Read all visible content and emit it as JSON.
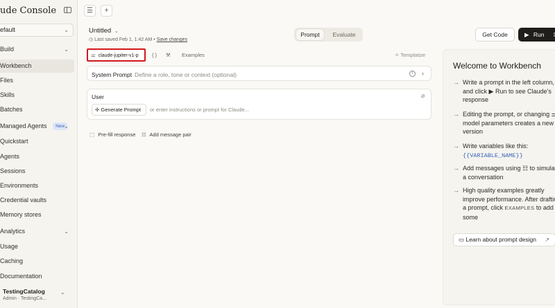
{
  "sidebar": {
    "brand": "ude Console",
    "workspace": "efault",
    "items": [
      {
        "label": "Build",
        "chevron": true
      },
      {
        "label": "Workbench",
        "active": true
      },
      {
        "label": "Files"
      },
      {
        "label": "Skills"
      },
      {
        "label": "Batches"
      },
      {
        "label": "Managed Agents",
        "badge": "New",
        "chevron": true
      },
      {
        "label": "Quickstart"
      },
      {
        "label": "Agents"
      },
      {
        "label": "Sessions"
      },
      {
        "label": "Environments"
      },
      {
        "label": "Credential vaults"
      },
      {
        "label": "Memory stores"
      },
      {
        "label": "Analytics",
        "chevron": true
      },
      {
        "label": "Usage"
      },
      {
        "label": "Caching"
      },
      {
        "label": "Documentation"
      }
    ],
    "user": {
      "name": "TestingCatalog",
      "sub": "Admin · TestingCa..."
    }
  },
  "header": {
    "doc_title": "Untitled",
    "saved_text": "Last saved Feb 1, 1:42 AM",
    "save_changes": "Save changes",
    "tabs": [
      "Prompt",
      "Evaluate"
    ],
    "active_tab": "Prompt",
    "get_code": "Get Code",
    "run": "Run"
  },
  "editor": {
    "model": "claude-jupiter-v1-p",
    "examples": "Examples",
    "templatize": "Templatize",
    "system_prompt_label": "System Prompt",
    "system_prompt_placeholder": "Define a role, tone or context (optional)",
    "user_label": "User",
    "generate_prompt": "Generate Prompt",
    "generate_placeholder": "or enter instructions or prompt for Claude...",
    "prefill": "Pre-fill response",
    "add_pair": "Add message pair"
  },
  "welcome": {
    "title": "Welcome to Workbench",
    "item1_a": "Write a prompt in the left column, and click",
    "item1_b": "Run to see Claude’s response",
    "item2_a": "Editing the prompt, or changing",
    "item2_b": "model parameters creates a new version",
    "item3_a": "Write variables like this:",
    "item3_var": "{{VARIABLE_NAME}}",
    "item4_a": "Add messages using",
    "item4_b": "to simulate a conversation",
    "item5_a": "High quality examples greatly improve performance. After drafting a prompt, click",
    "item5_code": "EXAMPLES",
    "item5_b": "to add some",
    "learn": "Learn about prompt design"
  },
  "colors": {
    "accent_red": "#d0191d",
    "run_bg": "#1f1e1b",
    "var_blue": "#3a63b8"
  }
}
